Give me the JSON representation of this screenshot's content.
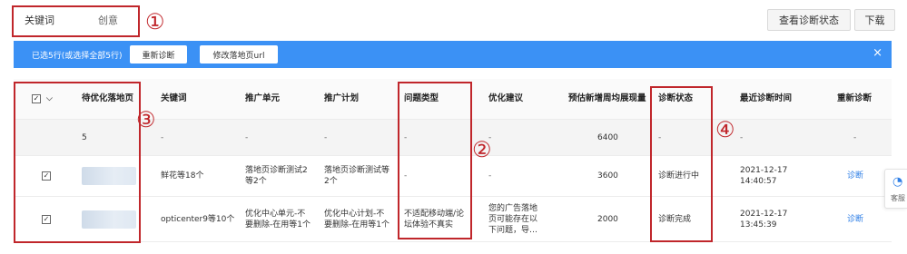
{
  "tabs": [
    {
      "label": "关键词",
      "active": true
    },
    {
      "label": "创意",
      "active": false
    }
  ],
  "toolbar": {
    "check_status_label": "查看诊断状态",
    "download_label": "下载"
  },
  "selection_bar": {
    "text": "已选5行(或选择全部5行)",
    "rediagnose_label": "重新诊断",
    "modify_url_label": "修改落地页url",
    "close_label": "×",
    "color": "#3b91f5"
  },
  "table": {
    "columns": [
      "待优化落地页",
      "关键词",
      "推广单元",
      "推广计划",
      "问题类型",
      "优化建议",
      "预估新增周均展现量",
      "诊断状态",
      "最近诊断时间",
      "重新诊断"
    ],
    "summary": {
      "landing": "5",
      "keyword": "-",
      "unit": "-",
      "plan": "-",
      "problem": "-",
      "suggestion": "-",
      "impressions": "6400",
      "status": "-",
      "time": "-",
      "action": "-"
    },
    "rows": [
      {
        "checked": true,
        "keyword": "鲜花等18个",
        "unit": "落地页诊断测试2等2个",
        "plan": "落地页诊断测试等2个",
        "problem": "-",
        "suggestion": "-",
        "impressions": "3600",
        "status": "诊断进行中",
        "time": "2021-12-17 14:40:57",
        "action": "诊断"
      },
      {
        "checked": true,
        "keyword": "opticenter9等10个",
        "unit": "优化中心单元-不要删除-在用等1个",
        "plan": "优化中心计划-不要删除-在用等1个",
        "problem": "不适配移动端/论坛体验不真实",
        "suggestion": "您的广告落地页可能存在以下问题，导…",
        "impressions": "2000",
        "status": "诊断完成",
        "time": "2021-12-17 13:45:39",
        "action": "诊断"
      }
    ]
  },
  "annotations": [
    "①",
    "②",
    "③",
    "④"
  ],
  "side_widget": {
    "icon": "customer-service-icon",
    "label": "客服"
  }
}
